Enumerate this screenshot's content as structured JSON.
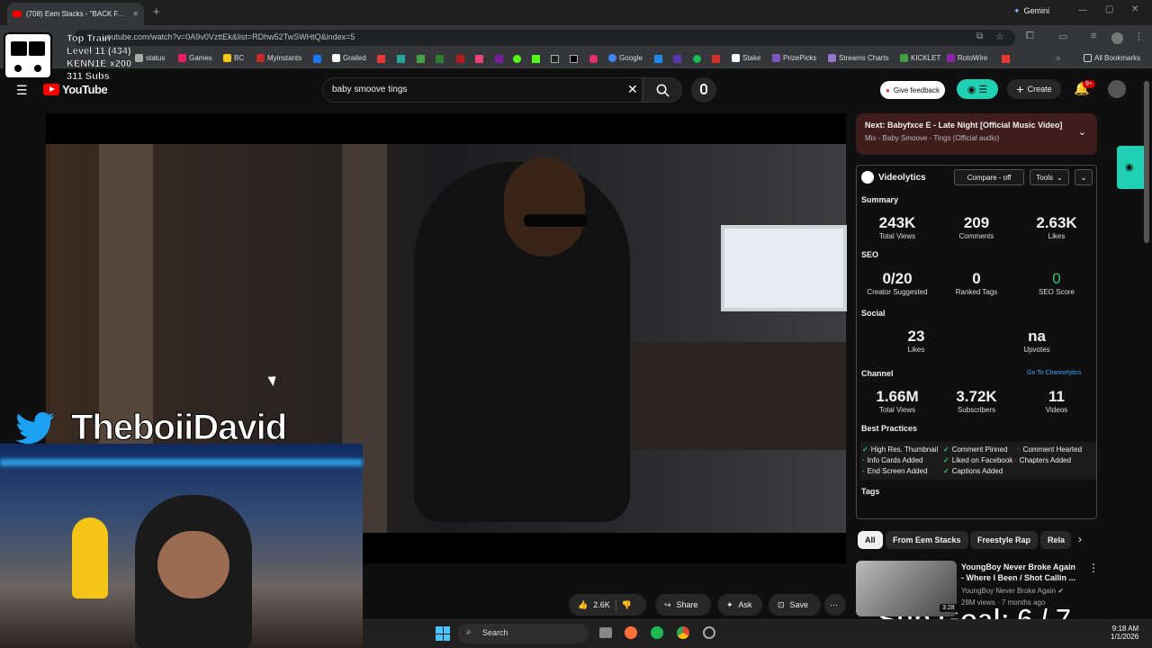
{
  "browser": {
    "tab_title": "(708) Eem Stacks - \"BACK F...",
    "gemini_label": "Gemini",
    "url": "youtube.com/watch?v=0A9v0VzttEk&list=RDhw52TwSWHtQ&index=5",
    "bookmarks": [
      "status",
      "Games",
      "BC",
      "Myinstants",
      "Grailed",
      "Google",
      "Stake",
      "PrizePicks",
      "Streams Charts",
      "KICKLET",
      "RotoWire"
    ],
    "all_bookmarks": "All Bookmarks"
  },
  "train_overlay": {
    "title": "Top Train",
    "level": "Level 11  (434)",
    "user": "KENN1E x200",
    "subs": "311 Subs"
  },
  "youtube": {
    "logo": "YouTube",
    "search_value": "baby smoove tings",
    "feedback": "Give feedback",
    "create": "Create",
    "notif_count": "9+"
  },
  "overlay": {
    "handle": "TheboiiDavid",
    "sub_goal": "Sub Goal:  6 / 7"
  },
  "next": {
    "label": "Next:",
    "title": "Babyfxce E - Late Night [Official Music Video]",
    "mix": "Mix - Baby Smoove - Tings (Official audio)"
  },
  "videolytics": {
    "title": "Videolytics",
    "compare": "Compare - off",
    "tools": "Tools",
    "summary": "Summary",
    "total_views": "243K",
    "total_views_l": "Total Views",
    "comments": "209",
    "comments_l": "Comments",
    "likes": "2.63K",
    "likes_l": "Likes",
    "seo": "SEO",
    "creator": "0/20",
    "creator_l": "Creator Suggested",
    "ranked": "0",
    "ranked_l": "Ranked Tags",
    "seo_score": "0",
    "seo_score_l": "SEO Score",
    "social": "Social",
    "s_likes": "23",
    "s_likes_l": "Likes",
    "upvotes": "na",
    "upvotes_l": "Upvotes",
    "channel": "Channel",
    "channel_link": "Go To Channelytics",
    "c_views": "1.66M",
    "c_views_l": "Total Views",
    "subs": "3.72K",
    "subs_l": "Subscribers",
    "videos": "11",
    "videos_l": "Videos",
    "best": "Best Practices",
    "tags": "Tags",
    "bp": [
      "High Res. Thumbnail",
      "Comment Pinned",
      "Comment Hearted",
      "Info Cards Added",
      "Liked on Facebook",
      "Chapters Added",
      "End Screen Added",
      "Captions Added"
    ]
  },
  "chips": [
    "All",
    "From Eem Stacks",
    "Freestyle Rap",
    "Rela"
  ],
  "rec": {
    "title": "YoungBoy Never Broke Again - Where I Been / Shot Callin ...",
    "channel": "YoungBoy Never Broke Again",
    "meta": "28M views · 7 months ago",
    "duration": "3:28"
  },
  "actions": {
    "likes": "2.6K",
    "share": "Share",
    "ask": "Ask",
    "save": "Save"
  },
  "taskbar": {
    "search": "Search",
    "time": "9:18 AM",
    "date": "1/1/2026"
  }
}
